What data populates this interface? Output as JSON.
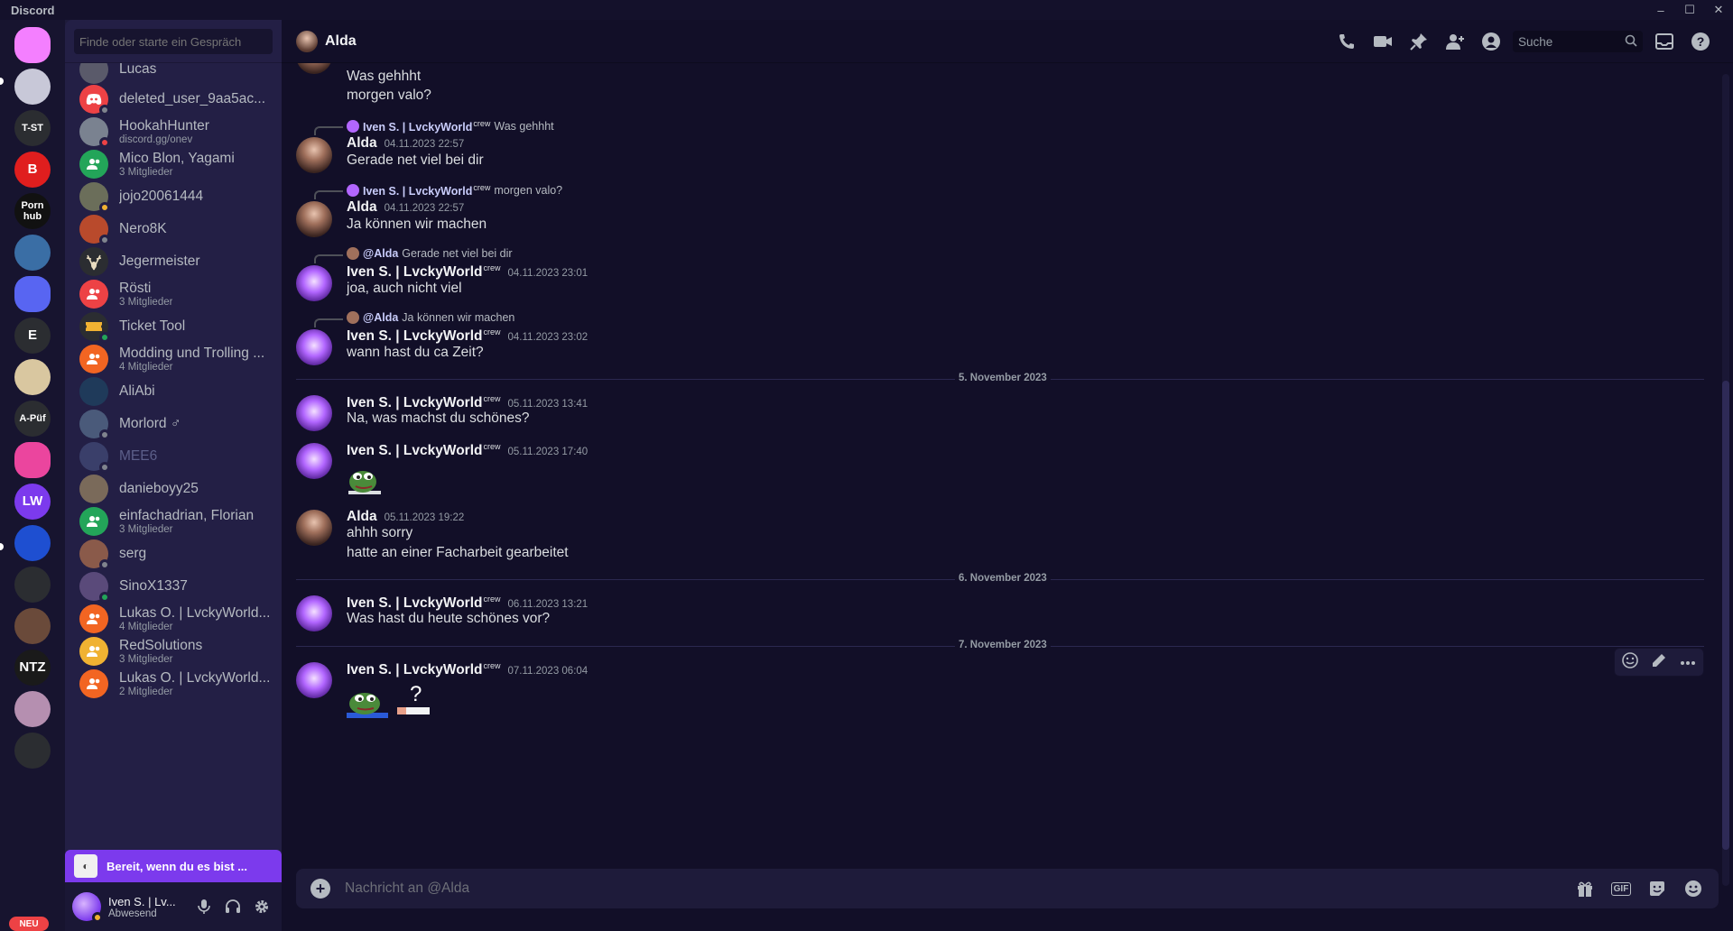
{
  "window": {
    "title": "Discord",
    "controls": [
      "–",
      "☐",
      "✕"
    ]
  },
  "servers": [
    {
      "name": "discord-home",
      "label": "",
      "color": "#f47fff"
    },
    {
      "name": "server-castle",
      "label": "",
      "color": "#c8c8d8"
    },
    {
      "name": "server-t-st",
      "label": "T-ST",
      "color": "#2b2d31"
    },
    {
      "name": "server-b",
      "label": "B",
      "color": "#e01e1e"
    },
    {
      "name": "server-ph",
      "label": "Porn hub",
      "color": "#111111"
    },
    {
      "name": "server-avatar",
      "label": "",
      "color": "#3a6ea5"
    },
    {
      "name": "server-folder",
      "label": "",
      "color": "#5865f2"
    },
    {
      "name": "server-e",
      "label": "E",
      "color": "#2b2d31"
    },
    {
      "name": "server-face",
      "label": "",
      "color": "#d9c7a0"
    },
    {
      "name": "server-a-puf",
      "label": "A-Püf",
      "color": "#2b2d31"
    },
    {
      "name": "server-pink-folder",
      "label": "",
      "color": "#eb459e"
    },
    {
      "name": "server-lw",
      "label": "LW",
      "color": "#7c3aed"
    },
    {
      "name": "server-cloud",
      "label": "",
      "color": "#1e4fd1"
    },
    {
      "name": "server-logs",
      "label": "",
      "color": "#2b2d31"
    },
    {
      "name": "server-person",
      "label": "",
      "color": "#6a4a3a"
    },
    {
      "name": "server-ntz",
      "label": "NTZ",
      "color": "#1a1a1a"
    },
    {
      "name": "server-girl",
      "label": "",
      "color": "#b58fb0"
    },
    {
      "name": "server-new",
      "label": "",
      "color": "#2b2d31"
    }
  ],
  "new_badge": "NEU",
  "sidebar": {
    "search_placeholder": "Finde oder starte ein Gespräch",
    "partial_top": "Lucas",
    "dms": [
      {
        "name": "deleted_user_9aa5ac...",
        "sub": "",
        "color": "#ed4245",
        "status": "#80848e",
        "icon": "discord-icon"
      },
      {
        "name": "HookahHunter",
        "sub": "discord.gg/onev",
        "color": "#7a8290",
        "status": "#ed4245",
        "icon": ""
      },
      {
        "name": "Mico Blon, Yagami",
        "sub": "3 Mitglieder",
        "color": "#23a559",
        "status": "",
        "icon": "group-icon"
      },
      {
        "name": "jojo20061444",
        "sub": "",
        "color": "#6b6e5a",
        "status": "#f0b232",
        "icon": ""
      },
      {
        "name": "Nero8K",
        "sub": "",
        "color": "#b94a2c",
        "status": "#80848e",
        "icon": ""
      },
      {
        "name": "Jegermeister",
        "sub": "",
        "color": "#2b2d31",
        "status": "",
        "icon": "deer-icon"
      },
      {
        "name": "Rösti",
        "sub": "3 Mitglieder",
        "color": "#ed4245",
        "status": "",
        "icon": "group-icon"
      },
      {
        "name": "Ticket Tool",
        "sub": "",
        "color": "#2b2d31",
        "status": "#23a559",
        "icon": "ticket-icon"
      },
      {
        "name": "Modding und Trolling ...",
        "sub": "4 Mitglieder",
        "color": "#f26522",
        "status": "",
        "icon": "group-icon"
      },
      {
        "name": "AliAbi",
        "sub": "",
        "color": "#1f3a5a",
        "status": "",
        "icon": ""
      },
      {
        "name": "Morlord ♂",
        "sub": "",
        "color": "#4a5a7a",
        "status": "#80848e",
        "icon": ""
      },
      {
        "name": "MEE6",
        "sub": "",
        "color": "#3a3f6a",
        "status": "#80848e",
        "icon": "",
        "muted": true
      },
      {
        "name": "danieboyy25",
        "sub": "",
        "color": "#7a6a5a",
        "status": "",
        "icon": ""
      },
      {
        "name": "einfachadrian, Florian",
        "sub": "3 Mitglieder",
        "color": "#23a559",
        "status": "",
        "icon": "group-icon"
      },
      {
        "name": "serg",
        "sub": "",
        "color": "#8a5a4a",
        "status": "#80848e",
        "icon": ""
      },
      {
        "name": "SinoX1337",
        "sub": "",
        "color": "#5a4a7a",
        "status": "#23a559",
        "icon": ""
      },
      {
        "name": "Lukas O. | LvckyWorld...",
        "sub": "4 Mitglieder",
        "color": "#f26522",
        "status": "",
        "icon": "group-icon"
      },
      {
        "name": "RedSolutions",
        "sub": "3 Mitglieder",
        "color": "#f0b232",
        "status": "",
        "icon": "group-icon"
      },
      {
        "name": "Lukas O. | LvckyWorld...",
        "sub": "2 Mitglieder",
        "color": "#f26522",
        "status": "",
        "icon": "group-icon"
      }
    ],
    "ready_banner": "Bereit, wenn du es bist ...",
    "user": {
      "name": "Iven S. | Lv...",
      "status": "Abwesend"
    }
  },
  "header": {
    "name": "Alda",
    "search_placeholder": "Suche",
    "tools": [
      "phone-icon",
      "video-icon",
      "pin-icon",
      "add-friend-icon",
      "profile-icon"
    ]
  },
  "messages": {
    "continuations_top": [
      "Was gehhht",
      "morgen valo?"
    ],
    "blocks": [
      {
        "author": "Alda",
        "time": "04.11.2023 22:57",
        "reply_to": "Iven S. | LvckyWorld",
        "reply_crew": "crew",
        "reply_text": "Was gehhht",
        "lines": [
          "Gerade net viel bei dir"
        ]
      },
      {
        "author": "Alda",
        "time": "04.11.2023 22:57",
        "reply_to": "Iven S. | LvckyWorld",
        "reply_crew": "crew",
        "reply_text": "morgen valo?",
        "lines": [
          "Ja können wir machen"
        ]
      },
      {
        "author": "Iven S. | LvckyWorld",
        "crew": "crew",
        "time": "04.11.2023 23:01",
        "reply_to": "@Alda",
        "reply_text": "Gerade net viel bei dir",
        "lines": [
          "joa, auch nicht viel"
        ]
      },
      {
        "author": "Iven S. | LvckyWorld",
        "crew": "crew",
        "time": "04.11.2023 23:02",
        "reply_to": "@Alda",
        "reply_text": "Ja können wir machen",
        "lines": [
          "wann hast du ca Zeit?"
        ]
      }
    ],
    "divider1": "5. November 2023",
    "nov5": [
      {
        "author": "Iven S. | LvckyWorld",
        "crew": "crew",
        "time": "05.11.2023 13:41",
        "lines": [
          "Na, was machst du schönes?"
        ]
      },
      {
        "author": "Iven S. | LvckyWorld",
        "crew": "crew",
        "time": "05.11.2023 17:40",
        "lines": []
      },
      {
        "author": "Alda",
        "time": "05.11.2023 19:22",
        "lines": [
          "ahhh sorry",
          "hatte an einer Facharbeit gearbeitet"
        ]
      }
    ],
    "divider2": "6. November 2023",
    "nov6": {
      "author": "Iven S. | LvckyWorld",
      "crew": "crew",
      "time": "06.11.2023 13:21",
      "lines": [
        "Was hast du heute schönes vor?"
      ]
    },
    "divider3": "7. November 2023",
    "nov7": {
      "author": "Iven S. | LvckyWorld",
      "crew": "crew",
      "time": "07.11.2023 06:04",
      "question": "?"
    }
  },
  "composer": {
    "placeholder": "Nachricht an @Alda",
    "gif_label": "GIF"
  }
}
